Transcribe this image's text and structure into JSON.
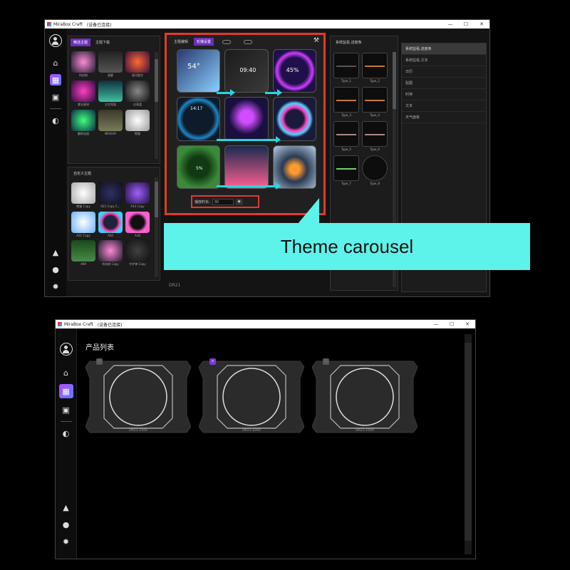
{
  "window_top": {
    "app_name": "MiraBox Craft",
    "status": "(设备已连接)",
    "controls": [
      "—",
      "☐",
      "✕"
    ],
    "rail_icons": [
      "avatar-icon",
      "home-icon",
      "apps-icon",
      "widgets-icon",
      "gamepad-icon",
      "learn-icon",
      "profile-icon",
      "settings-icon"
    ],
    "left_panel": {
      "tabs": [
        "精选主题",
        "主题下载"
      ],
      "items": [
        "科技粉",
        "画廊",
        "银河星空",
        "紫光星球",
        "太空弯道",
        "仪表盘",
        "翻转加速",
        "NES639",
        "熊猫"
      ]
    },
    "custom_panel": {
      "title": "自定义主题",
      "items": [
        "熊猫 Copy",
        "A21 Copy C...",
        "A14 Copy",
        "A21 Copy",
        "A20",
        "A18",
        "A09",
        "科技粉 Copy",
        "守护神 Copy"
      ]
    },
    "carousel": {
      "tabs": [
        "主题编辑",
        "轮播设置"
      ],
      "play_label": "播放时长:",
      "play_value": "30",
      "tools_icon": "tools-icon",
      "tiles": [
        {
          "text": "54°",
          "c1": "#2a3a70",
          "c2": "#8ad0ff"
        },
        {
          "text": "09:40",
          "c1": "#1b1b1b",
          "c2": "#3a3a3a"
        },
        {
          "text": "45%",
          "c1": "#20104a",
          "c2": "#d03cff"
        },
        {
          "text": "14:17",
          "c1": "#0d1b2a",
          "c2": "#1c86c8"
        },
        {
          "text": "",
          "c1": "#1a1040",
          "c2": "#d04cff"
        },
        {
          "text": "",
          "c1": "#1a1a3a",
          "c2": "#50d0ff"
        },
        {
          "text": "5%",
          "c1": "#123a12",
          "c2": "#3a8a3a"
        },
        {
          "text": "",
          "c1": "#1a2a50",
          "c2": "#ff6090"
        },
        {
          "text": "",
          "c1": "#2a3a50",
          "c2": "#a0b8d0"
        }
      ]
    },
    "footer_label": "DR21",
    "type_panel": {
      "title": "系统监看,进度条",
      "types": [
        "Type_1",
        "Type_2",
        "Type_3",
        "Type_4",
        "Type_5",
        "Type_6",
        "Type_7",
        "Type_8"
      ]
    },
    "list_panel": {
      "items": [
        "系统监看,进度条",
        "系统监看,文本",
        "日历",
        "贴图",
        "时钟",
        "文本",
        "天气面板"
      ]
    }
  },
  "callout": {
    "text": "Theme carousel",
    "color": "#5ef3ea"
  },
  "window_bottom": {
    "app_name": "MiraBox Craft",
    "status": "(设备已连接)",
    "controls": [
      "—",
      "☐",
      "✕"
    ],
    "title": "产品列表",
    "products": [
      {
        "label": "DR21-2160"
      },
      {
        "label": "DR21-2040"
      },
      {
        "label": "DR21-2160"
      }
    ]
  }
}
